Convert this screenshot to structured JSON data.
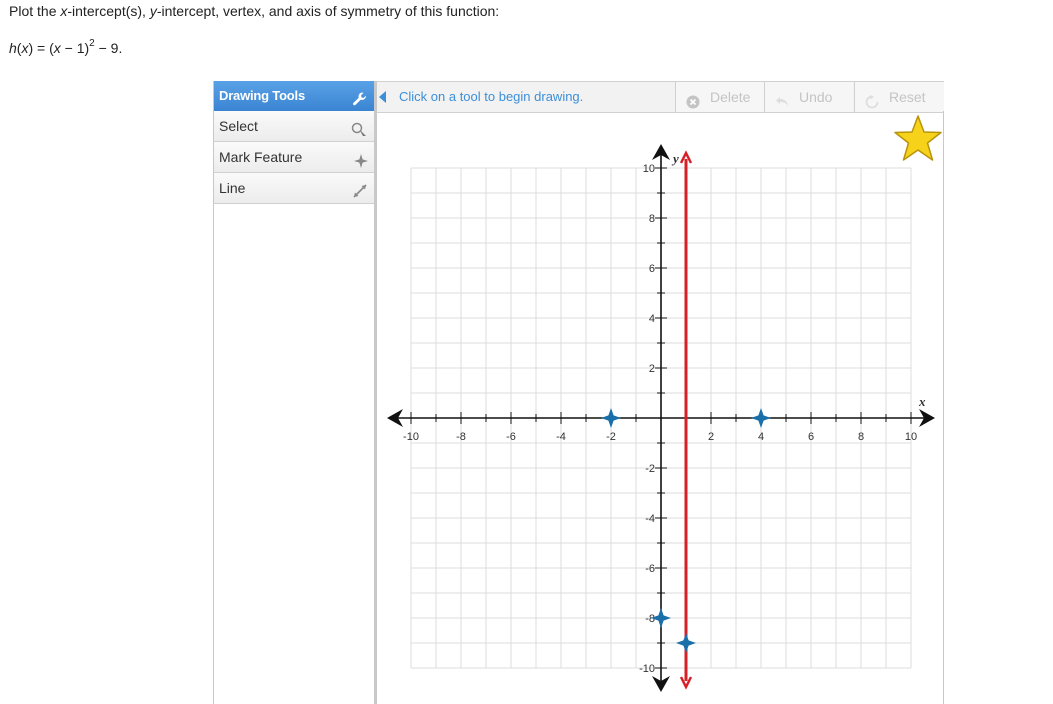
{
  "question": {
    "instruction_parts": [
      "Plot the ",
      "x",
      "-intercept(s), ",
      "y",
      "-intercept, vertex, and axis of symmetry of this function:"
    ],
    "equation_parts": [
      "h",
      "(",
      "x",
      ") = (",
      "x",
      " − 1)",
      "2",
      " − 9."
    ]
  },
  "tools": {
    "header": "Drawing Tools",
    "items": [
      {
        "label": "Select",
        "icon": "cursor-icon"
      },
      {
        "label": "Mark Feature",
        "icon": "sparkle-icon"
      },
      {
        "label": "Line",
        "icon": "line-tool-icon"
      }
    ]
  },
  "toolbar": {
    "hint": "Click on a tool to begin drawing.",
    "delete": "Delete",
    "undo": "Undo",
    "reset": "Reset"
  },
  "colors": {
    "accent": "#3a84d2",
    "line": "#d62027",
    "point": "#1a6fa8",
    "star": "#f7d21b"
  },
  "graph": {
    "x_axis_label": "x",
    "y_axis_label": "y",
    "x_range": [
      -10,
      10
    ],
    "y_range": [
      -10,
      10
    ],
    "x_tick_labels": [
      "-10",
      "-8",
      "-6",
      "-4",
      "-2",
      "2",
      "4",
      "6",
      "8",
      "10"
    ],
    "y_tick_labels": [
      "10",
      "8",
      "6",
      "4",
      "2",
      "-2",
      "-4",
      "-6",
      "-8",
      "-10"
    ],
    "grid": true,
    "points": [
      {
        "name": "x-intercept-left",
        "x": -2,
        "y": 0
      },
      {
        "name": "x-intercept-right",
        "x": 4,
        "y": 0
      },
      {
        "name": "y-intercept",
        "x": 0,
        "y": -8
      },
      {
        "name": "vertex",
        "x": 1,
        "y": -9
      }
    ],
    "axis_of_symmetry_x": 1
  }
}
